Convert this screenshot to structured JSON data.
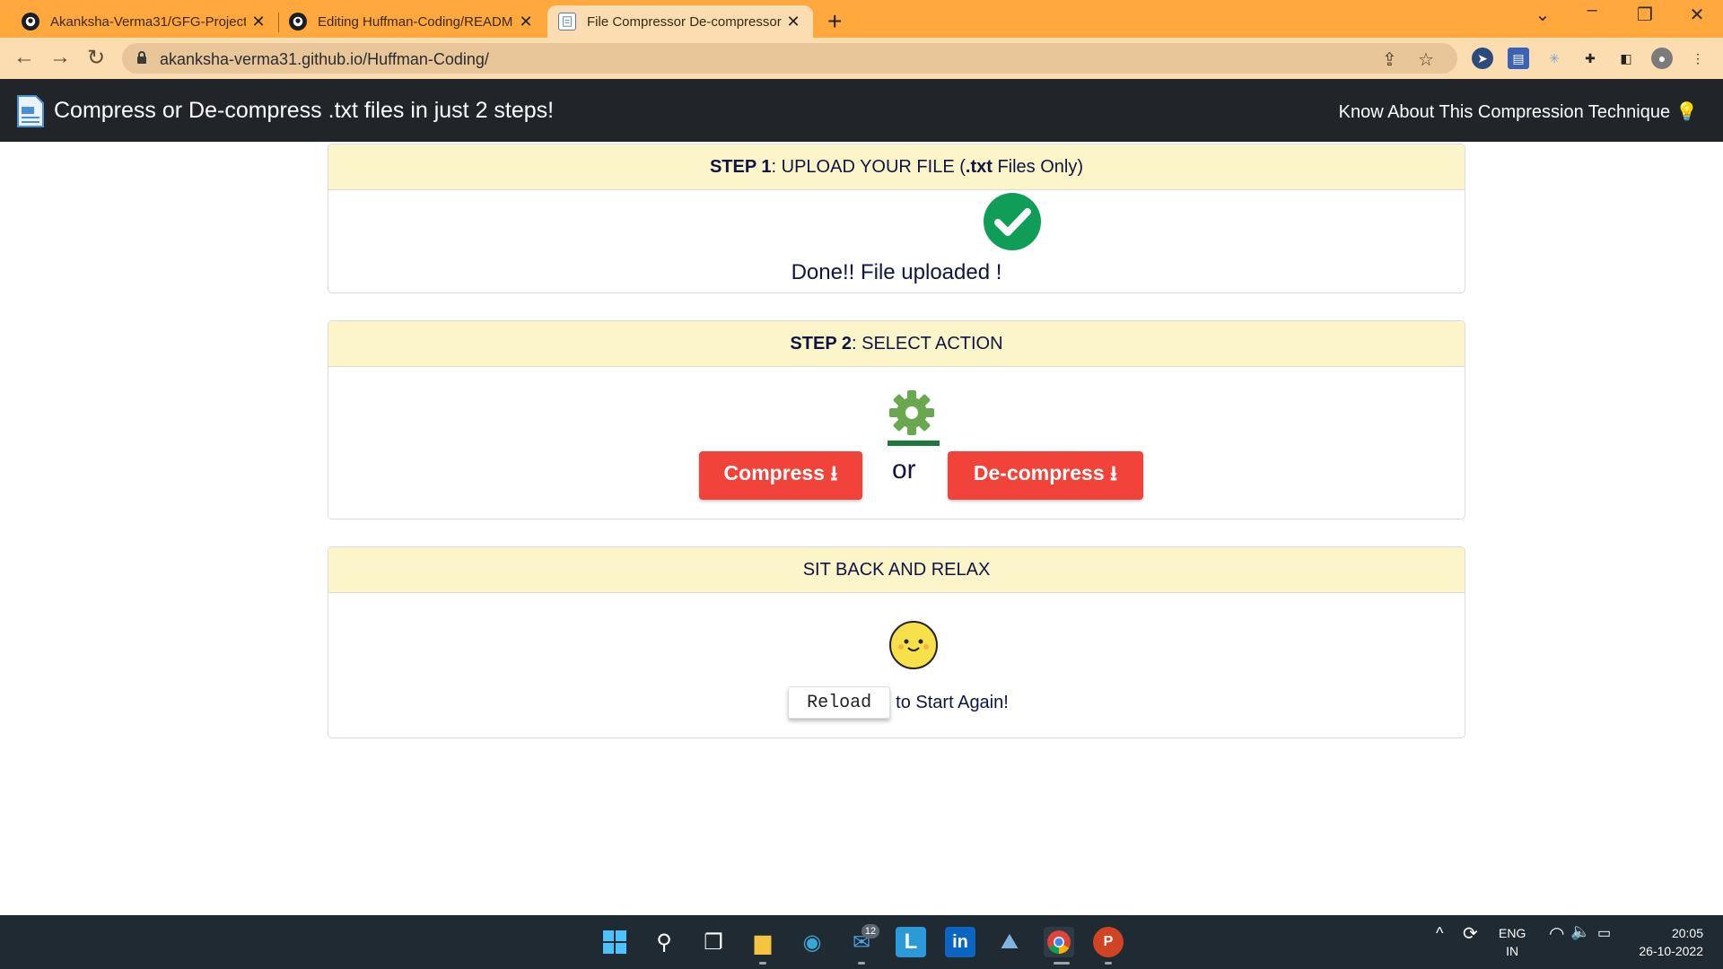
{
  "browser": {
    "tabs": [
      {
        "title": "Akanksha-Verma31/GFG-Project"
      },
      {
        "title": "Editing Huffman-Coding/READM"
      },
      {
        "title": "File Compressor De-compressor"
      }
    ],
    "new_tab": "+",
    "url": "akanksha-verma31.github.io/Huffman-Coding/"
  },
  "app": {
    "brand": "Compress or De-compress .txt files in just 2 steps!",
    "about_link": "Know About This Compression Technique",
    "about_icon": "💡"
  },
  "step1": {
    "label_bold": "STEP 1",
    "label_rest": ": UPLOAD YOUR FILE (",
    "ext_bold": ".txt",
    "label_tail": " Files Only)",
    "status": "Done!! File uploaded !"
  },
  "step2": {
    "label_bold": "STEP 2",
    "label_rest": ": SELECT ACTION",
    "compress_label": "Compress ⭳",
    "or_text": "or",
    "decompress_label": "De-compress ⭳"
  },
  "step3": {
    "label": "SIT BACK AND RELAX",
    "reload_label": "Reload",
    "reload_suffix": "to Start Again!"
  },
  "taskbar": {
    "mail_badge": "12",
    "lang_top": "ENG",
    "lang_bottom": "IN",
    "time": "20:05",
    "date": "26-10-2022"
  },
  "colors": {
    "tab_strip": "#ffa83d",
    "toolbar": "#fcdcb1",
    "navbar": "#212529",
    "card_header": "#fbf5c9",
    "action_button": "#f2433a",
    "check_green": "#0f9d58",
    "gear_green": "#6aa84f"
  }
}
